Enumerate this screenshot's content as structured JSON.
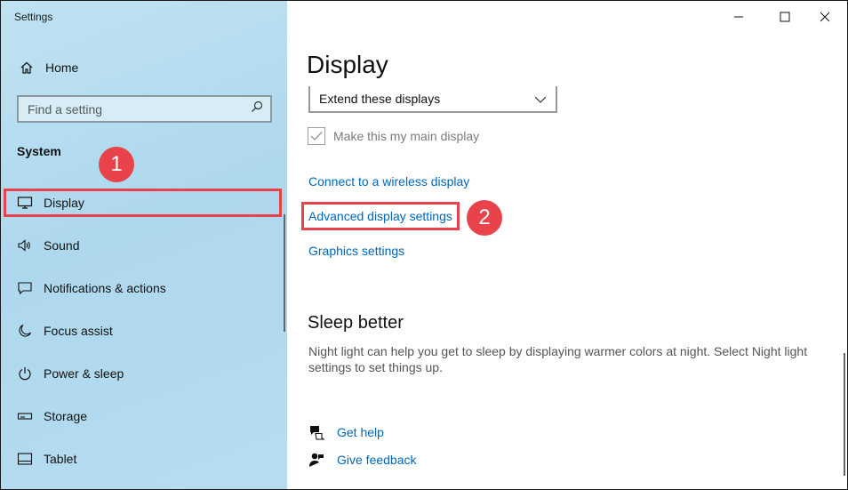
{
  "app": {
    "title": "Settings"
  },
  "sidebar": {
    "home_label": "Home",
    "search": {
      "placeholder": "Find a setting"
    },
    "section_label": "System",
    "items": [
      {
        "label": "Display",
        "icon": "monitor-icon"
      },
      {
        "label": "Sound",
        "icon": "speaker-icon"
      },
      {
        "label": "Notifications & actions",
        "icon": "notifications-icon"
      },
      {
        "label": "Focus assist",
        "icon": "moon-icon"
      },
      {
        "label": "Power & sleep",
        "icon": "power-icon"
      },
      {
        "label": "Storage",
        "icon": "storage-icon"
      },
      {
        "label": "Tablet",
        "icon": "tablet-icon"
      }
    ]
  },
  "main": {
    "title": "Display",
    "multiple_displays": {
      "selected": "Extend these displays"
    },
    "main_display_checkbox": {
      "label": "Make this my main display",
      "checked": true,
      "disabled": true
    },
    "links": [
      {
        "label": "Connect to a wireless display"
      },
      {
        "label": "Advanced display settings"
      },
      {
        "label": "Graphics settings"
      }
    ],
    "sleep": {
      "title": "Sleep better",
      "description": "Night light can help you get to sleep by displaying warmer colors at night. Select Night light settings to set things up."
    },
    "help": [
      {
        "label": "Get help",
        "icon": "help-chat-icon"
      },
      {
        "label": "Give feedback",
        "icon": "feedback-icon"
      }
    ]
  },
  "annotations": {
    "step1": "1",
    "step2": "2",
    "color": "#e8434b"
  },
  "colors": {
    "link": "#0067b8",
    "sidebar_bg": "#b6dcef"
  }
}
